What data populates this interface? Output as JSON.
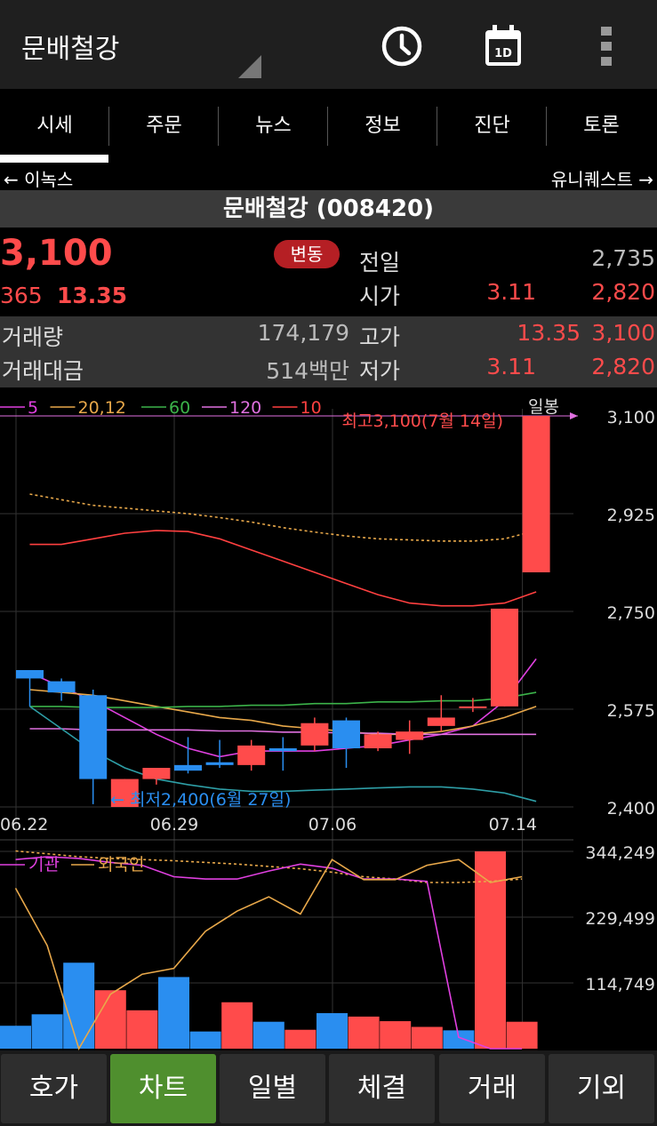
{
  "header": {
    "title": "문배철강"
  },
  "tabs": [
    {
      "label": "시세"
    },
    {
      "label": "주문"
    },
    {
      "label": "뉴스"
    },
    {
      "label": "정보"
    },
    {
      "label": "진단"
    },
    {
      "label": "토론"
    }
  ],
  "nav": {
    "prev": "← 이녹스",
    "next": "유니퀘스트 →"
  },
  "stock": {
    "name": "문배철강 (008420)",
    "price": "3,100",
    "change": "365",
    "change_pct": "13.35",
    "badge": "변동"
  },
  "quote": {
    "prev_close_label": "전일",
    "prev_close": "2,735",
    "open_label": "시가",
    "open_pct": "3.11",
    "open": "2,820",
    "volume_label": "거래량",
    "volume": "174,179",
    "high_label": "고가",
    "high_pct": "13.35",
    "high": "3,100",
    "amount_label": "거래대금",
    "amount": "514백만",
    "low_label": "저가",
    "low_pct": "3.11",
    "low": "2,820"
  },
  "chart_data": [
    {
      "type": "candlestick",
      "period_label": "일봉",
      "legend": [
        {
          "name": "5",
          "color": "#e040e0"
        },
        {
          "name": "20,12",
          "color": "#e8a84a"
        },
        {
          "name": "60",
          "color": "#3cb34a"
        },
        {
          "name": "120",
          "color": "#e070e0"
        },
        {
          "name": "10",
          "color": "#ff4040"
        }
      ],
      "y_ticks": [
        "3,100",
        "2,925",
        "2,750",
        "2,575",
        "2,400"
      ],
      "ylim": [
        2400,
        3100
      ],
      "x_ticks": [
        {
          "label": "06.22",
          "index": 0
        },
        {
          "label": "06.29",
          "index": 5
        },
        {
          "label": "07.06",
          "index": 10
        },
        {
          "label": "07.14",
          "index": 16
        }
      ],
      "annotations": {
        "high": "최고3,100(7월 14일)",
        "low": "최저2,400(6월 27일)"
      },
      "candles": [
        {
          "o": 2645,
          "h": 2645,
          "c": 2630,
          "l": 2580
        },
        {
          "o": 2625,
          "h": 2630,
          "c": 2605,
          "l": 2590
        },
        {
          "o": 2600,
          "h": 2610,
          "c": 2450,
          "l": 2405
        },
        {
          "o": 2400,
          "h": 2450,
          "c": 2450,
          "l": 2400
        },
        {
          "o": 2450,
          "h": 2470,
          "c": 2470,
          "l": 2440
        },
        {
          "o": 2475,
          "h": 2525,
          "c": 2465,
          "l": 2460
        },
        {
          "o": 2480,
          "h": 2520,
          "c": 2475,
          "l": 2470
        },
        {
          "o": 2475,
          "h": 2520,
          "c": 2510,
          "l": 2465
        },
        {
          "o": 2505,
          "h": 2525,
          "c": 2500,
          "l": 2465
        },
        {
          "o": 2510,
          "h": 2560,
          "c": 2550,
          "l": 2500
        },
        {
          "o": 2555,
          "h": 2560,
          "c": 2505,
          "l": 2470
        },
        {
          "o": 2505,
          "h": 2535,
          "c": 2530,
          "l": 2500
        },
        {
          "o": 2520,
          "h": 2555,
          "c": 2535,
          "l": 2495
        },
        {
          "o": 2545,
          "h": 2600,
          "c": 2560,
          "l": 2535
        },
        {
          "o": 2580,
          "h": 2595,
          "c": 2580,
          "l": 2570
        },
        {
          "o": 2580,
          "h": 2755,
          "c": 2755,
          "l": 2580
        },
        {
          "o": 2820,
          "h": 3100,
          "c": 3100,
          "l": 2820
        }
      ],
      "ma_series": [
        {
          "name": "5",
          "color": "#e040e0",
          "values": [
            2640,
            2615,
            2590,
            2560,
            2530,
            2505,
            2490,
            2500,
            2500,
            2500,
            2505,
            2510,
            2520,
            2530,
            2545,
            2590,
            2665
          ]
        },
        {
          "name": "20,12",
          "color": "#e8a84a",
          "values": [
            2610,
            2605,
            2600,
            2590,
            2580,
            2570,
            2560,
            2555,
            2545,
            2540,
            2535,
            2530,
            2530,
            2535,
            2545,
            2560,
            2580
          ]
        },
        {
          "name": "60",
          "color": "#3cb34a",
          "values": [
            2580,
            2580,
            2578,
            2578,
            2578,
            2580,
            2580,
            2582,
            2582,
            2585,
            2585,
            2588,
            2588,
            2590,
            2590,
            2595,
            2605
          ]
        },
        {
          "name": "120",
          "color": "#e070e0",
          "values": [
            2540,
            2540,
            2538,
            2538,
            2538,
            2538,
            2536,
            2536,
            2534,
            2534,
            2532,
            2532,
            2530,
            2530,
            2530,
            2530,
            2530
          ]
        },
        {
          "name": "10",
          "color": "#ff4040",
          "values": [
            2870,
            2870,
            2880,
            2890,
            2895,
            2893,
            2880,
            2860,
            2840,
            2820,
            2800,
            2780,
            2765,
            2760,
            2760,
            2765,
            2785
          ]
        },
        {
          "name": "band-upper",
          "color": "#e8a84a",
          "values": [
            2960,
            2950,
            2940,
            2935,
            2930,
            2925,
            2918,
            2910,
            2900,
            2892,
            2885,
            2880,
            2878,
            2876,
            2876,
            2880,
            2895
          ]
        },
        {
          "name": "band-lower",
          "color": "#2e9ea6",
          "values": [
            2580,
            2540,
            2500,
            2470,
            2450,
            2440,
            2432,
            2428,
            2428,
            2430,
            2432,
            2434,
            2436,
            2436,
            2432,
            2425,
            2410
          ]
        }
      ]
    },
    {
      "type": "bar",
      "legend": [
        {
          "name": "기관",
          "color": "#e040e0"
        },
        {
          "name": "외국인",
          "color": "#e8a84a"
        }
      ],
      "y_ticks": [
        "344,249",
        "229,499",
        "114,749"
      ],
      "ylim": [
        0,
        344249
      ],
      "volumes": [
        40000,
        60000,
        150000,
        102000,
        67000,
        125000,
        30000,
        81000,
        47000,
        33000,
        62000,
        56000,
        48000,
        38000,
        32000,
        344249,
        47000
      ],
      "up": [
        false,
        false,
        false,
        true,
        true,
        false,
        false,
        true,
        false,
        true,
        false,
        true,
        true,
        true,
        false,
        true,
        true
      ],
      "institution": [
        330000,
        335000,
        332000,
        325000,
        320000,
        300000,
        296000,
        296000,
        310000,
        322000,
        315000,
        296000,
        296000,
        292000,
        20000,
        0,
        0
      ],
      "foreign": [
        280000,
        180000,
        0,
        95000,
        130000,
        140000,
        205000,
        240000,
        265000,
        235000,
        330000,
        295000,
        295000,
        320000,
        330000,
        290000,
        300000
      ],
      "avg_line": [
        345000,
        340000,
        335000,
        332000,
        330000,
        328000,
        325000,
        322000,
        318000,
        314000,
        308000,
        300000,
        296000,
        290000,
        290000,
        292000,
        296000
      ]
    }
  ],
  "bottom_nav": [
    {
      "label": "호가"
    },
    {
      "label": "차트"
    },
    {
      "label": "일별"
    },
    {
      "label": "체결"
    },
    {
      "label": "거래"
    },
    {
      "label": "기외"
    }
  ],
  "colors": {
    "up": "#ff4b4b",
    "down": "#2a8ef0",
    "active_tab": "#4f8f2e"
  }
}
